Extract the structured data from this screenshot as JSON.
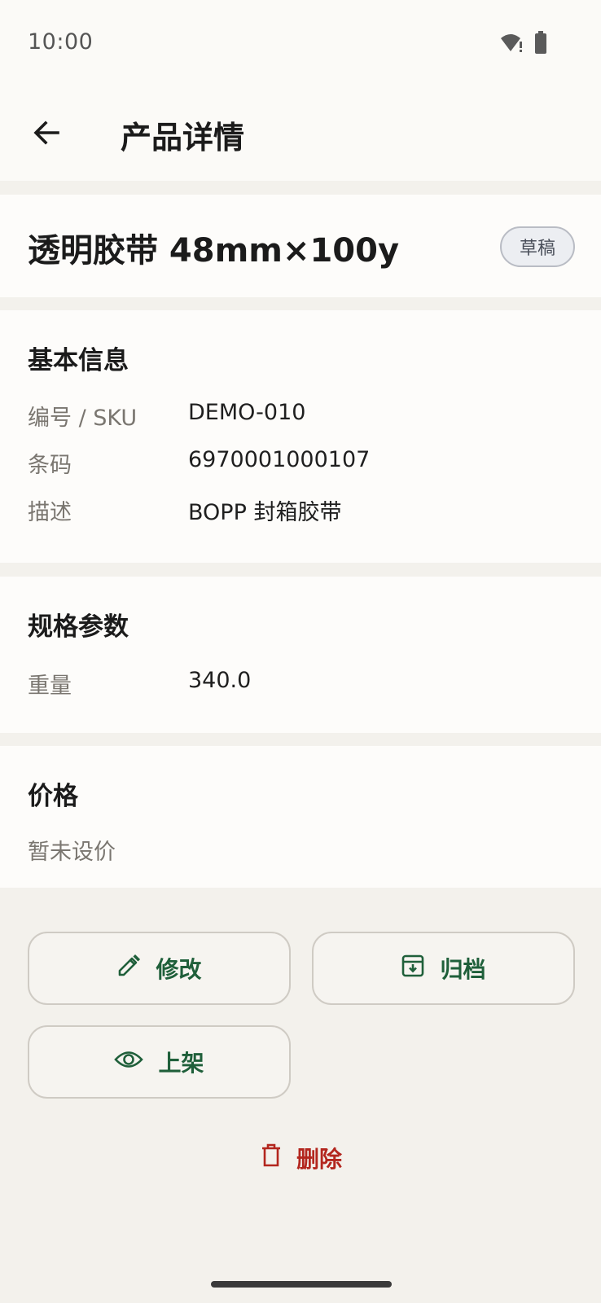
{
  "status_bar": {
    "time": "10:00",
    "icons": [
      "wifi-alert-icon",
      "battery-icon"
    ]
  },
  "app_bar": {
    "title": "产品详情",
    "back_icon": "arrow-back-icon"
  },
  "product": {
    "name": "透明胶带 48mm×100y",
    "status": "草稿"
  },
  "basic_info": {
    "title": "基本信息",
    "rows": [
      {
        "label": "编号 / SKU",
        "value": "DEMO-010"
      },
      {
        "label": "条码",
        "value": "6970001000107"
      },
      {
        "label": "描述",
        "value": "BOPP 封箱胶带"
      }
    ]
  },
  "specs": {
    "title": "规格参数",
    "rows": [
      {
        "label": "重量",
        "value": "340.0"
      }
    ]
  },
  "price": {
    "title": "价格",
    "empty_text": "暂未设价"
  },
  "actions": {
    "edit": "修改",
    "archive": "归档",
    "publish": "上架",
    "delete": "删除"
  },
  "colors": {
    "accent_green": "#1f5f3a",
    "danger_red": "#b3261e",
    "background": "#f3f1ec"
  }
}
